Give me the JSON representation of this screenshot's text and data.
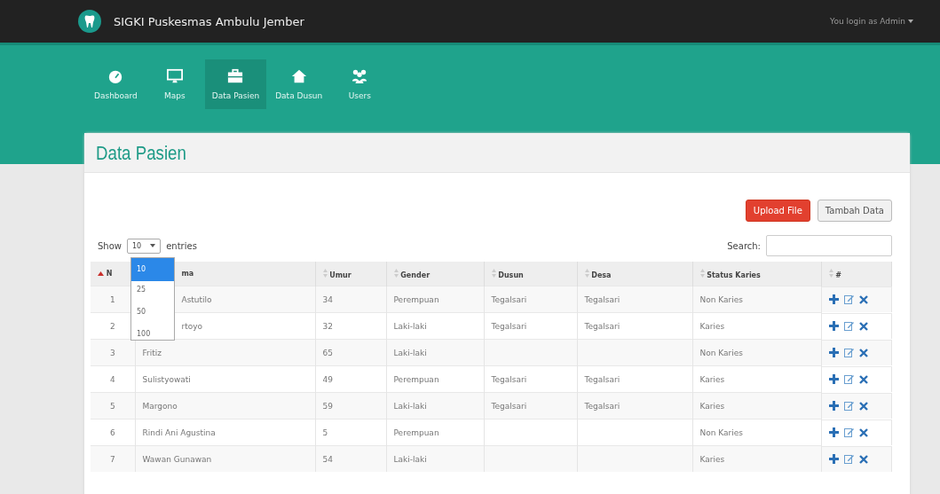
{
  "brand": {
    "title": "SIGKI Puskesmas Ambulu Jember"
  },
  "user_menu": {
    "label": "You login as Admin"
  },
  "nav": [
    {
      "label": "Dashboard",
      "selected": false
    },
    {
      "label": "Maps",
      "selected": false
    },
    {
      "label": "Data Pasien",
      "selected": true
    },
    {
      "label": "Data Dusun",
      "selected": false
    },
    {
      "label": "Users",
      "selected": false
    }
  ],
  "page_title": "Data Pasien",
  "buttons": [
    {
      "label": "Upload File",
      "kind": "danger"
    },
    {
      "label": "Tambah Data",
      "kind": "default"
    }
  ],
  "length": {
    "before": "Show",
    "value": "10",
    "after": "entries",
    "options": [
      {
        "label": "10",
        "selected": true
      },
      {
        "label": "25",
        "selected": false
      },
      {
        "label": "50",
        "selected": false
      },
      {
        "label": "100",
        "selected": false
      }
    ]
  },
  "search": {
    "label": "Search:"
  },
  "table": {
    "columns": [
      {
        "label": "N"
      },
      {
        "label": "ma"
      },
      {
        "label": "Umur"
      },
      {
        "label": "Gender"
      },
      {
        "label": "Dusun"
      },
      {
        "label": "Desa"
      },
      {
        "label": "Status Karies"
      },
      {
        "label": "#"
      }
    ],
    "rows": [
      {
        "no": "1",
        "nama": "Astutilo",
        "covered": true,
        "umur": "34",
        "gender": "Perempuan",
        "dusun": "Tegalsari",
        "desa": "Tegalsari",
        "status": "Non Karies"
      },
      {
        "no": "2",
        "nama": "rtoyo",
        "covered": true,
        "umur": "32",
        "gender": "Laki-laki",
        "dusun": "Tegalsari",
        "desa": "Tegalsari",
        "status": "Karies"
      },
      {
        "no": "3",
        "nama": "Fritiz",
        "covered": false,
        "umur": "65",
        "gender": "Laki-laki",
        "dusun": "",
        "desa": "",
        "status": "Non Karies"
      },
      {
        "no": "4",
        "nama": "Sulistyowati",
        "covered": false,
        "umur": "49",
        "gender": "Perempuan",
        "dusun": "Tegalsari",
        "desa": "Tegalsari",
        "status": "Karies"
      },
      {
        "no": "5",
        "nama": "Margono",
        "covered": false,
        "umur": "59",
        "gender": "Laki-laki",
        "dusun": "Tegalsari",
        "desa": "Tegalsari",
        "status": "Karies"
      },
      {
        "no": "6",
        "nama": "Rindi Ani Agustina",
        "covered": false,
        "umur": "5",
        "gender": "Perempuan",
        "dusun": "",
        "desa": "",
        "status": "Non Karies"
      },
      {
        "no": "7",
        "nama": "Wawan Gunawan",
        "covered": false,
        "umur": "54",
        "gender": "Laki-laki",
        "dusun": "",
        "desa": "",
        "status": "Karies"
      }
    ]
  }
}
